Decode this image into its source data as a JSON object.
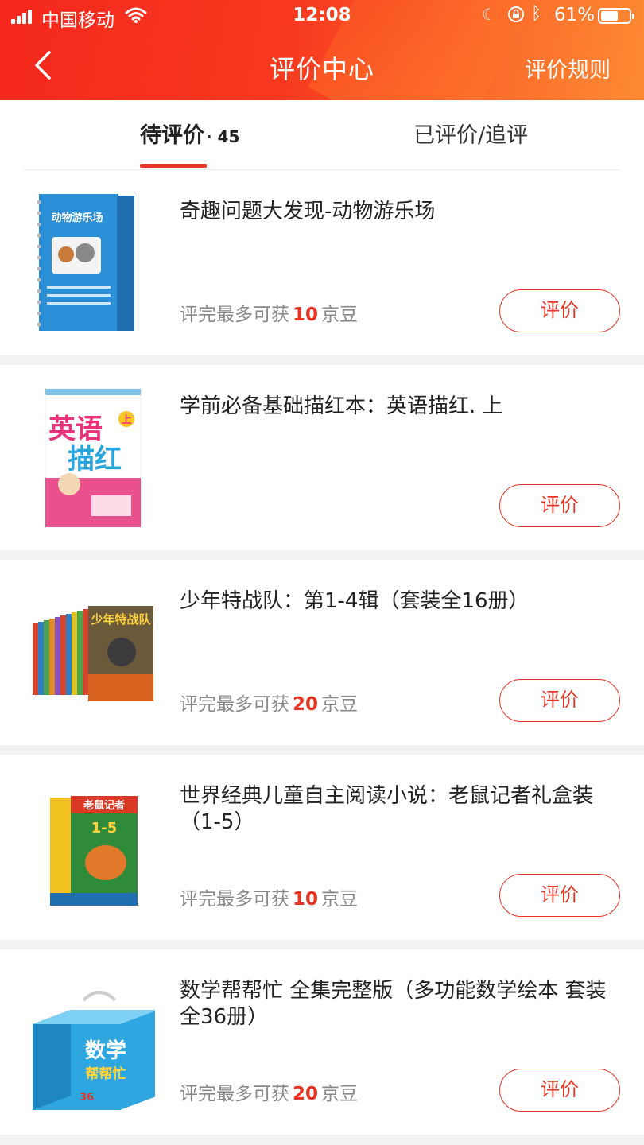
{
  "status_bar": {
    "carrier": "中国移动",
    "time": "12:08",
    "battery_percent": "61%",
    "battery_level": 0.61
  },
  "header": {
    "title": "评价中心",
    "rules_label": "评价规则",
    "back_icon": "chevron-left-icon"
  },
  "tabs": {
    "pending_label": "待评价",
    "pending_count": "· 45",
    "reviewed_label": "已评价/追评"
  },
  "colors": {
    "accent": "#e93323",
    "header_start": "#f4271c",
    "header_end": "#fd8a33"
  },
  "reward_prefix": "评完最多可获",
  "reward_suffix": "京豆",
  "items": [
    {
      "name": "奇趣问题大发现-动物游乐场",
      "reward": "10",
      "button": "评价",
      "show_reward": true
    },
    {
      "name": "学前必备基础描红本：英语描红. 上",
      "reward": "",
      "button": "评价",
      "show_reward": false
    },
    {
      "name": "少年特战队：第1-4辑（套装全16册）",
      "reward": "20",
      "button": "评价",
      "show_reward": true
    },
    {
      "name": "世界经典儿童自主阅读小说：老鼠记者礼盒装（1-5）",
      "reward": "10",
      "button": "评价",
      "show_reward": true
    },
    {
      "name": "数学帮帮忙 全集完整版（多功能数学绘本 套装全36册）",
      "reward": "20",
      "button": "评价",
      "show_reward": true
    }
  ],
  "covers": {
    "item0_title": "动物游乐场",
    "item1_title_a": "英语",
    "item1_title_b": "描红",
    "item1_badge": "上",
    "item2_title": "少年特战队",
    "item3_title": "老鼠记者",
    "item3_badge": "1-5",
    "item4_title_a": "数学",
    "item4_title_b": "帮帮忙",
    "item4_badge": "36"
  }
}
